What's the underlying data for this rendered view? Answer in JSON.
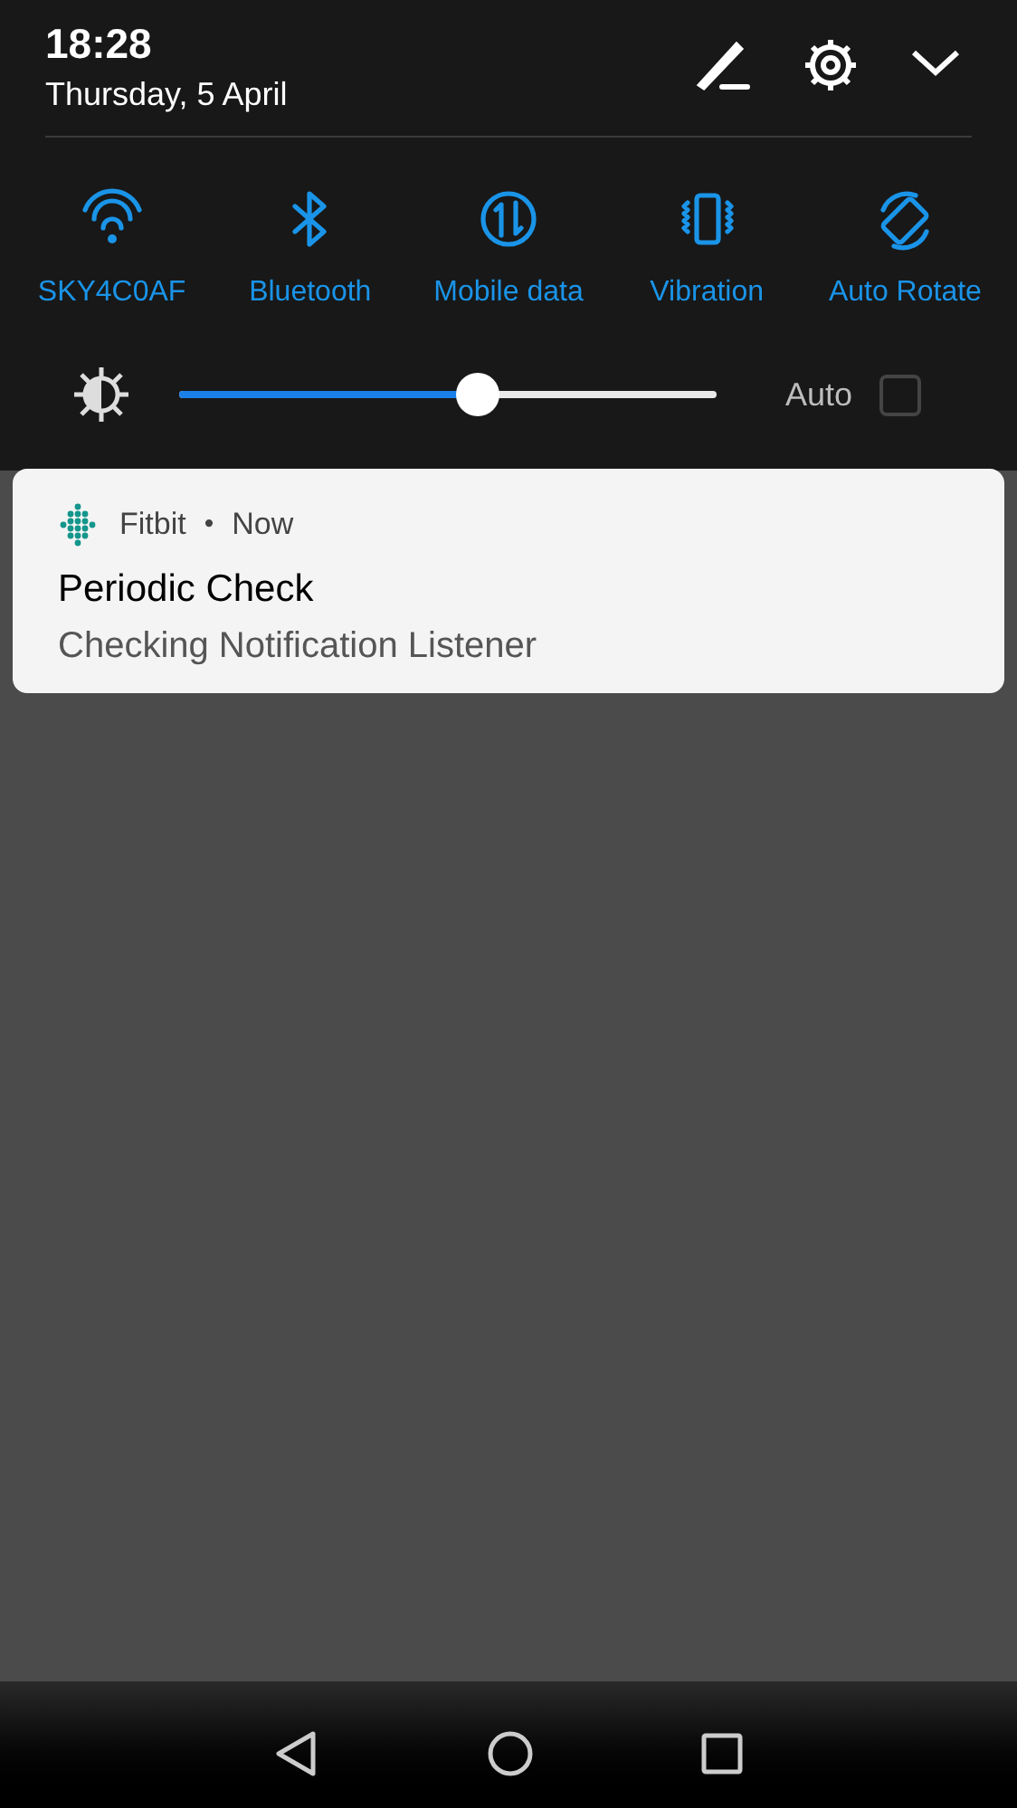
{
  "header": {
    "time": "18:28",
    "date": "Thursday, 5 April"
  },
  "tiles": [
    {
      "kind": "wifi",
      "label": "SKY4C0AF",
      "on": true
    },
    {
      "kind": "bluetooth",
      "label": "Bluetooth",
      "on": true
    },
    {
      "kind": "data",
      "label": "Mobile data",
      "on": true
    },
    {
      "kind": "vibration",
      "label": "Vibration",
      "on": true
    },
    {
      "kind": "rotate",
      "label": "Auto Rotate",
      "on": true
    }
  ],
  "brightness": {
    "level": 0.554,
    "auto_label": "Auto",
    "auto_checked": false
  },
  "notification": {
    "app": "Fitbit",
    "separator": "•",
    "time": "Now",
    "title": "Periodic Check",
    "text": "Checking Notification Listener"
  }
}
